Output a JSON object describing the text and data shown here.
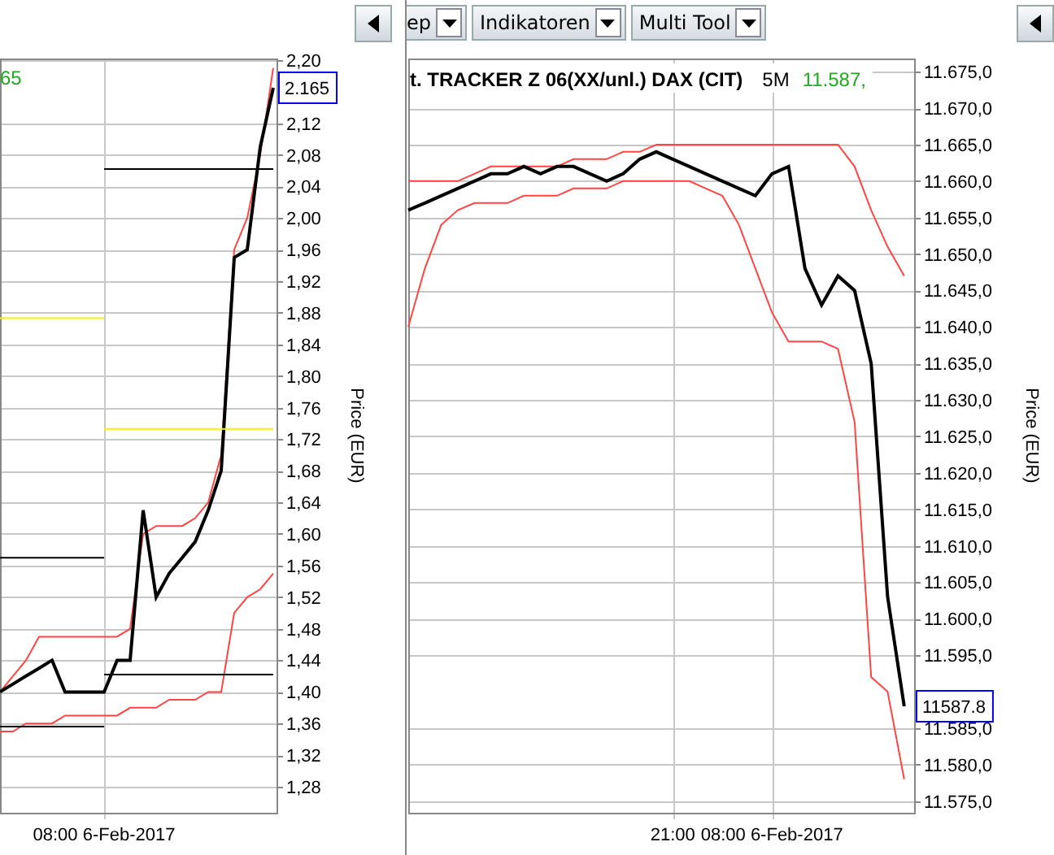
{
  "left_panel": {
    "chart": {
      "header_value": "65",
      "last_value": "2.165",
      "chart_data": {
        "type": "line",
        "ylabel": "Price (EUR)",
        "categories": [
          null,
          null,
          null,
          null,
          null,
          null,
          null,
          null,
          "08:00 6-Feb-2017",
          null,
          null,
          null,
          null,
          null,
          null,
          null,
          null,
          null,
          null,
          null,
          null,
          null
        ],
        "grid": true,
        "ylim": [
          1.247,
          2.202
        ],
        "yticks": [
          {
            "value": 2.2,
            "label": "2,20"
          },
          {
            "value": 2.12,
            "label": "2,12"
          },
          {
            "value": 2.08,
            "label": "2,08"
          },
          {
            "value": 2.04,
            "label": "2,04"
          },
          {
            "value": 2.0,
            "label": "2,00"
          },
          {
            "value": 1.96,
            "label": "1,96"
          },
          {
            "value": 1.92,
            "label": "1,92"
          },
          {
            "value": 1.88,
            "label": "1,88"
          },
          {
            "value": 1.84,
            "label": "1,84"
          },
          {
            "value": 1.8,
            "label": "1,80"
          },
          {
            "value": 1.76,
            "label": "1,76"
          },
          {
            "value": 1.72,
            "label": "1,72"
          },
          {
            "value": 1.68,
            "label": "1,68"
          },
          {
            "value": 1.64,
            "label": "1,64"
          },
          {
            "value": 1.6,
            "label": "1,60"
          },
          {
            "value": 1.56,
            "label": "1,56"
          },
          {
            "value": 1.52,
            "label": "1,52"
          },
          {
            "value": 1.48,
            "label": "1,48"
          },
          {
            "value": 1.44,
            "label": "1,44"
          },
          {
            "value": 1.4,
            "label": "1,40"
          },
          {
            "value": 1.36,
            "label": "1,36"
          },
          {
            "value": 1.32,
            "label": "1,32"
          },
          {
            "value": 1.28,
            "label": "1,28"
          }
        ],
        "series": [
          {
            "color": "#ff4444",
            "values": [
              1.4,
              1.42,
              1.44,
              1.47,
              1.47,
              1.47,
              1.47,
              1.47,
              1.47,
              1.47,
              1.48,
              1.6,
              1.61,
              1.61,
              1.61,
              1.62,
              1.64,
              1.7,
              1.96,
              2.0,
              2.08,
              2.19
            ]
          },
          {
            "color": "#ff4444",
            "values": [
              1.35,
              1.35,
              1.36,
              1.36,
              1.36,
              1.37,
              1.37,
              1.37,
              1.37,
              1.37,
              1.38,
              1.38,
              1.38,
              1.39,
              1.39,
              1.39,
              1.4,
              1.4,
              1.5,
              1.52,
              1.53,
              1.55
            ]
          },
          {
            "color": "#000000",
            "values": [
              1.4,
              1.41,
              1.42,
              1.43,
              1.44,
              1.4,
              1.4,
              1.4,
              1.4,
              1.44,
              1.44,
              1.63,
              1.52,
              1.55,
              1.57,
              1.59,
              1.63,
              1.68,
              1.95,
              1.96,
              2.09,
              2.165
            ]
          },
          {
            "color": "#000000",
            "values": [
              null,
              null,
              null,
              null,
              null,
              null,
              null,
              null,
              2.062,
              2.062,
              2.062,
              2.062,
              2.062,
              2.062,
              2.062,
              2.062,
              2.062,
              2.062,
              2.062,
              2.062,
              2.062,
              2.062
            ]
          },
          {
            "color": "#ffee00",
            "values": [
              1.873,
              1.873,
              1.873,
              1.873,
              1.873,
              1.873,
              1.873,
              1.873,
              1.873,
              null,
              null,
              null,
              null,
              null,
              null,
              null,
              null,
              null,
              null,
              null,
              null,
              null
            ]
          },
          {
            "color": "#ffee00",
            "values": [
              null,
              null,
              null,
              null,
              null,
              null,
              null,
              null,
              1.733,
              1.733,
              1.733,
              1.733,
              1.733,
              1.733,
              1.733,
              1.733,
              1.733,
              1.733,
              1.733,
              1.733,
              1.733,
              1.733
            ]
          },
          {
            "color": "#000000",
            "values": [
              1.57,
              1.57,
              1.57,
              1.57,
              1.57,
              1.57,
              1.57,
              1.57,
              1.57,
              null,
              null,
              null,
              null,
              null,
              null,
              null,
              null,
              null,
              null,
              null,
              null,
              null
            ]
          },
          {
            "color": "#000000",
            "values": [
              null,
              null,
              null,
              null,
              null,
              null,
              null,
              null,
              1.422,
              1.422,
              1.422,
              1.422,
              1.422,
              1.422,
              1.422,
              1.422,
              1.422,
              1.422,
              1.422,
              1.422,
              1.422,
              1.422
            ]
          },
          {
            "color": "#000000",
            "values": [
              1.356,
              1.356,
              1.356,
              1.356,
              1.356,
              1.356,
              1.356,
              1.356,
              1.356,
              null,
              null,
              null,
              null,
              null,
              null,
              null,
              null,
              null,
              null,
              null,
              null,
              null
            ]
          }
        ]
      }
    }
  },
  "right_panel": {
    "toolbar": [
      {
        "label": "ep"
      },
      {
        "label": "Indikatoren"
      },
      {
        "label": "Multi Tool"
      }
    ],
    "chart": {
      "title": "t. TRACKER Z 06(XX/unl.) DAX (CIT)",
      "interval": "5M",
      "header_value": "11.587,",
      "last_value": "11587.8",
      "chart_data": {
        "type": "line",
        "ylabel": "Price (EUR)",
        "categories": [
          null,
          null,
          null,
          null,
          null,
          null,
          null,
          null,
          null,
          null,
          null,
          null,
          null,
          null,
          null,
          null,
          "21:00",
          null,
          null,
          null,
          null,
          null,
          "08:00 6-Feb-2017",
          null,
          null,
          null,
          null,
          null,
          null,
          null,
          null
        ],
        "grid": true,
        "ylim": [
          11573.4,
          11676.8
        ],
        "yticks": [
          {
            "value": 11675,
            "label": "11.675,0"
          },
          {
            "value": 11670,
            "label": "11.670,0"
          },
          {
            "value": 11665,
            "label": "11.665,0"
          },
          {
            "value": 11660,
            "label": "11.660,0"
          },
          {
            "value": 11655,
            "label": "11.655,0"
          },
          {
            "value": 11650,
            "label": "11.650,0"
          },
          {
            "value": 11645,
            "label": "11.645,0"
          },
          {
            "value": 11640,
            "label": "11.640,0"
          },
          {
            "value": 11635,
            "label": "11.635,0"
          },
          {
            "value": 11630,
            "label": "11.630,0"
          },
          {
            "value": 11625,
            "label": "11.625,0"
          },
          {
            "value": 11620,
            "label": "11.620,0"
          },
          {
            "value": 11615,
            "label": "11.615,0"
          },
          {
            "value": 11610,
            "label": "11.610,0"
          },
          {
            "value": 11605,
            "label": "11.605,0"
          },
          {
            "value": 11600,
            "label": "11.600,0"
          },
          {
            "value": 11595,
            "label": "11.595,0"
          },
          {
            "value": 11585,
            "label": "11.585,0"
          },
          {
            "value": 11580,
            "label": "11.580,0"
          },
          {
            "value": 11575,
            "label": "11.575,0"
          }
        ],
        "series": [
          {
            "color": "#ff4444",
            "values": [
              11660,
              11660,
              11660,
              11660,
              11661,
              11662,
              11662,
              11662,
              11662,
              11662,
              11663,
              11663,
              11663,
              11664,
              11664,
              11665,
              11665,
              11665,
              11665,
              11665,
              11665,
              11665,
              11665,
              11665,
              11665,
              11665,
              11665,
              11662,
              11656,
              11651,
              11647
            ]
          },
          {
            "color": "#ff4444",
            "values": [
              11640,
              11648,
              11654,
              11656,
              11657,
              11657,
              11657,
              11658,
              11658,
              11658,
              11659,
              11659,
              11659,
              11660,
              11660,
              11660,
              11660,
              11660,
              11659,
              11658,
              11654,
              11648,
              11642,
              11638,
              11638,
              11638,
              11637,
              11627,
              11592,
              11590,
              11578
            ]
          },
          {
            "color": "#000000",
            "values": [
              11656,
              11657,
              11658,
              11659,
              11660,
              11661,
              11661,
              11662,
              11661,
              11662,
              11662,
              11661,
              11660,
              11661,
              11663,
              11664,
              11663,
              11662,
              11661,
              11660,
              11659,
              11658,
              11661,
              11662,
              11648,
              11643,
              11647,
              11645,
              11635,
              11603,
              11588
            ]
          }
        ]
      }
    }
  }
}
